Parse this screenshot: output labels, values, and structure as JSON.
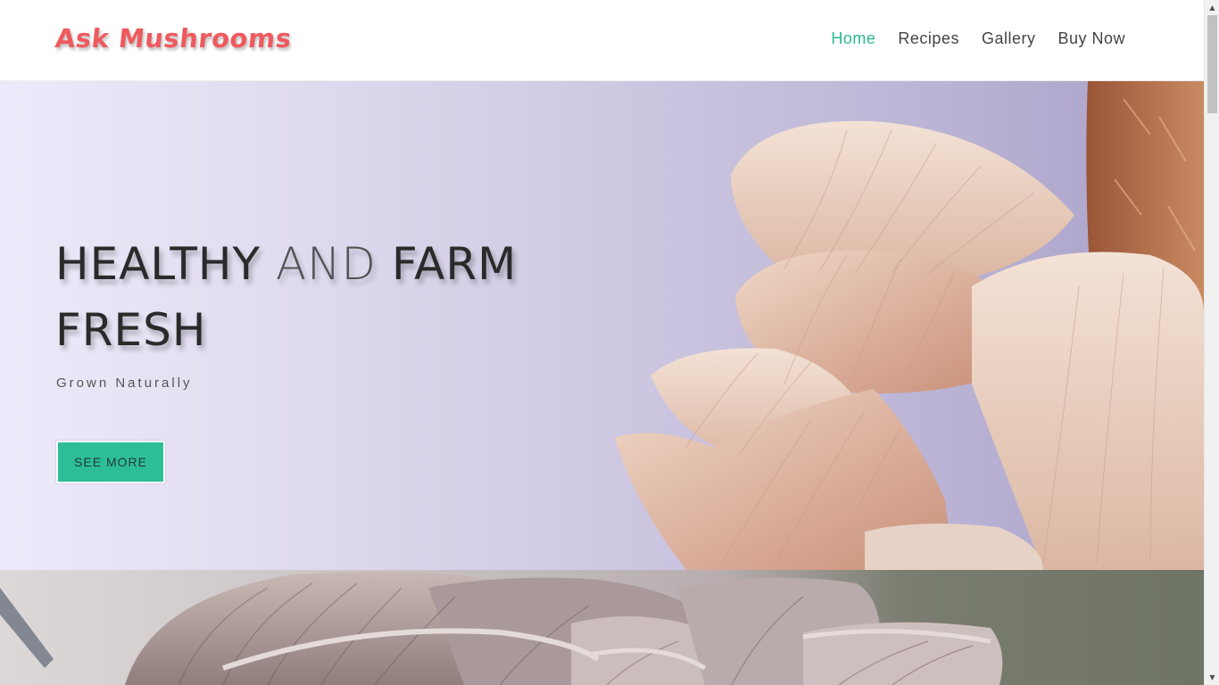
{
  "header": {
    "logo": "Ask Mushrooms",
    "nav": [
      {
        "label": "Home",
        "active": true
      },
      {
        "label": "Recipes",
        "active": false
      },
      {
        "label": "Gallery",
        "active": false
      },
      {
        "label": "Buy Now",
        "active": false
      }
    ]
  },
  "hero": {
    "title_part1": "HEALTHY ",
    "title_part2": "AND",
    "title_part3": " FARM FRESH",
    "subtitle": "Grown Naturally",
    "button_label": "SEE MORE"
  },
  "colors": {
    "logo": "#ef5a5f",
    "nav_active": "#2bb894",
    "button": "#2dbe98"
  },
  "icons": {
    "scroll_up": "triangle-up",
    "scroll_down": "triangle-down"
  }
}
